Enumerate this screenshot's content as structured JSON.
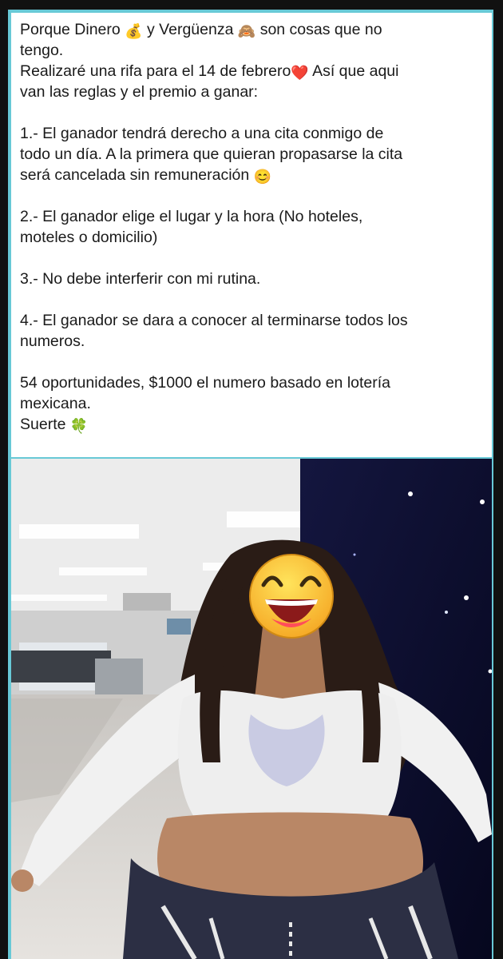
{
  "post": {
    "intro_line1": "Porque Dinero",
    "intro_emoji1": "💰",
    "intro_mid": "y Vergüenza",
    "intro_emoji2": "🙈",
    "intro_end": "son cosas que no",
    "intro_line2": "tengo.",
    "raffle_line1": "Realizaré una rifa para el 14 de febrero",
    "raffle_emoji": "❤️",
    "raffle_line1_end": "Así que aqui",
    "raffle_line2": "van las reglas y el premio a ganar:",
    "rules": [
      {
        "lines": [
          "1.- El ganador tendrá derecho a una cita conmigo de",
          "todo un día. A la primera que quieran propasarse la cita",
          "será cancelada sin remuneración"
        ],
        "emoji": "😊"
      },
      {
        "lines": [
          "2.- El ganador elige el lugar y la hora (No hoteles,",
          "moteles o domicilio)"
        ]
      },
      {
        "lines": [
          "3.- No debe interferir con mi rutina."
        ]
      },
      {
        "lines": [
          "4.- El ganador se dara a conocer al terminarse todos los",
          "numeros."
        ]
      }
    ],
    "closing_line1": "54 oportunidades, $1000 el numero basado en lotería",
    "closing_line2": "mexicana.",
    "closing_line3": "Suerte",
    "closing_emoji": "🍀"
  },
  "photo": {
    "subject_face_cover": "laughing-face-emoji",
    "colors": {
      "accent_border": "#68c9d6",
      "airport_ceiling": "#e9e9e9",
      "starry_wall": "#0b0d33",
      "top_color": "#eeeeee",
      "hair": "#2a1c16",
      "skin": "#b98766",
      "pants": "#2c2f44"
    }
  }
}
